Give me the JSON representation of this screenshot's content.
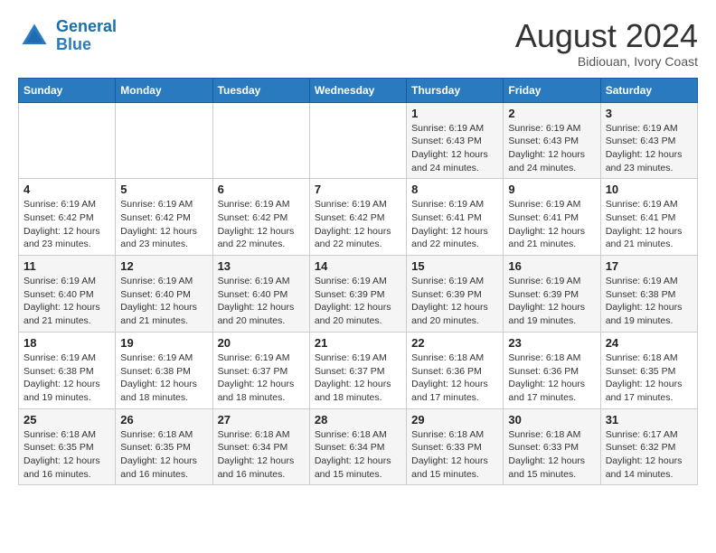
{
  "header": {
    "logo_line1": "General",
    "logo_line2": "Blue",
    "month": "August 2024",
    "location": "Bidiouan, Ivory Coast"
  },
  "days_of_week": [
    "Sunday",
    "Monday",
    "Tuesday",
    "Wednesday",
    "Thursday",
    "Friday",
    "Saturday"
  ],
  "weeks": [
    [
      {
        "day": "",
        "info": ""
      },
      {
        "day": "",
        "info": ""
      },
      {
        "day": "",
        "info": ""
      },
      {
        "day": "",
        "info": ""
      },
      {
        "day": "1",
        "info": "Sunrise: 6:19 AM\nSunset: 6:43 PM\nDaylight: 12 hours\nand 24 minutes."
      },
      {
        "day": "2",
        "info": "Sunrise: 6:19 AM\nSunset: 6:43 PM\nDaylight: 12 hours\nand 24 minutes."
      },
      {
        "day": "3",
        "info": "Sunrise: 6:19 AM\nSunset: 6:43 PM\nDaylight: 12 hours\nand 23 minutes."
      }
    ],
    [
      {
        "day": "4",
        "info": "Sunrise: 6:19 AM\nSunset: 6:42 PM\nDaylight: 12 hours\nand 23 minutes."
      },
      {
        "day": "5",
        "info": "Sunrise: 6:19 AM\nSunset: 6:42 PM\nDaylight: 12 hours\nand 23 minutes."
      },
      {
        "day": "6",
        "info": "Sunrise: 6:19 AM\nSunset: 6:42 PM\nDaylight: 12 hours\nand 22 minutes."
      },
      {
        "day": "7",
        "info": "Sunrise: 6:19 AM\nSunset: 6:42 PM\nDaylight: 12 hours\nand 22 minutes."
      },
      {
        "day": "8",
        "info": "Sunrise: 6:19 AM\nSunset: 6:41 PM\nDaylight: 12 hours\nand 22 minutes."
      },
      {
        "day": "9",
        "info": "Sunrise: 6:19 AM\nSunset: 6:41 PM\nDaylight: 12 hours\nand 21 minutes."
      },
      {
        "day": "10",
        "info": "Sunrise: 6:19 AM\nSunset: 6:41 PM\nDaylight: 12 hours\nand 21 minutes."
      }
    ],
    [
      {
        "day": "11",
        "info": "Sunrise: 6:19 AM\nSunset: 6:40 PM\nDaylight: 12 hours\nand 21 minutes."
      },
      {
        "day": "12",
        "info": "Sunrise: 6:19 AM\nSunset: 6:40 PM\nDaylight: 12 hours\nand 21 minutes."
      },
      {
        "day": "13",
        "info": "Sunrise: 6:19 AM\nSunset: 6:40 PM\nDaylight: 12 hours\nand 20 minutes."
      },
      {
        "day": "14",
        "info": "Sunrise: 6:19 AM\nSunset: 6:39 PM\nDaylight: 12 hours\nand 20 minutes."
      },
      {
        "day": "15",
        "info": "Sunrise: 6:19 AM\nSunset: 6:39 PM\nDaylight: 12 hours\nand 20 minutes."
      },
      {
        "day": "16",
        "info": "Sunrise: 6:19 AM\nSunset: 6:39 PM\nDaylight: 12 hours\nand 19 minutes."
      },
      {
        "day": "17",
        "info": "Sunrise: 6:19 AM\nSunset: 6:38 PM\nDaylight: 12 hours\nand 19 minutes."
      }
    ],
    [
      {
        "day": "18",
        "info": "Sunrise: 6:19 AM\nSunset: 6:38 PM\nDaylight: 12 hours\nand 19 minutes."
      },
      {
        "day": "19",
        "info": "Sunrise: 6:19 AM\nSunset: 6:38 PM\nDaylight: 12 hours\nand 18 minutes."
      },
      {
        "day": "20",
        "info": "Sunrise: 6:19 AM\nSunset: 6:37 PM\nDaylight: 12 hours\nand 18 minutes."
      },
      {
        "day": "21",
        "info": "Sunrise: 6:19 AM\nSunset: 6:37 PM\nDaylight: 12 hours\nand 18 minutes."
      },
      {
        "day": "22",
        "info": "Sunrise: 6:18 AM\nSunset: 6:36 PM\nDaylight: 12 hours\nand 17 minutes."
      },
      {
        "day": "23",
        "info": "Sunrise: 6:18 AM\nSunset: 6:36 PM\nDaylight: 12 hours\nand 17 minutes."
      },
      {
        "day": "24",
        "info": "Sunrise: 6:18 AM\nSunset: 6:35 PM\nDaylight: 12 hours\nand 17 minutes."
      }
    ],
    [
      {
        "day": "25",
        "info": "Sunrise: 6:18 AM\nSunset: 6:35 PM\nDaylight: 12 hours\nand 16 minutes."
      },
      {
        "day": "26",
        "info": "Sunrise: 6:18 AM\nSunset: 6:35 PM\nDaylight: 12 hours\nand 16 minutes."
      },
      {
        "day": "27",
        "info": "Sunrise: 6:18 AM\nSunset: 6:34 PM\nDaylight: 12 hours\nand 16 minutes."
      },
      {
        "day": "28",
        "info": "Sunrise: 6:18 AM\nSunset: 6:34 PM\nDaylight: 12 hours\nand 15 minutes."
      },
      {
        "day": "29",
        "info": "Sunrise: 6:18 AM\nSunset: 6:33 PM\nDaylight: 12 hours\nand 15 minutes."
      },
      {
        "day": "30",
        "info": "Sunrise: 6:18 AM\nSunset: 6:33 PM\nDaylight: 12 hours\nand 15 minutes."
      },
      {
        "day": "31",
        "info": "Sunrise: 6:17 AM\nSunset: 6:32 PM\nDaylight: 12 hours\nand 14 minutes."
      }
    ]
  ]
}
